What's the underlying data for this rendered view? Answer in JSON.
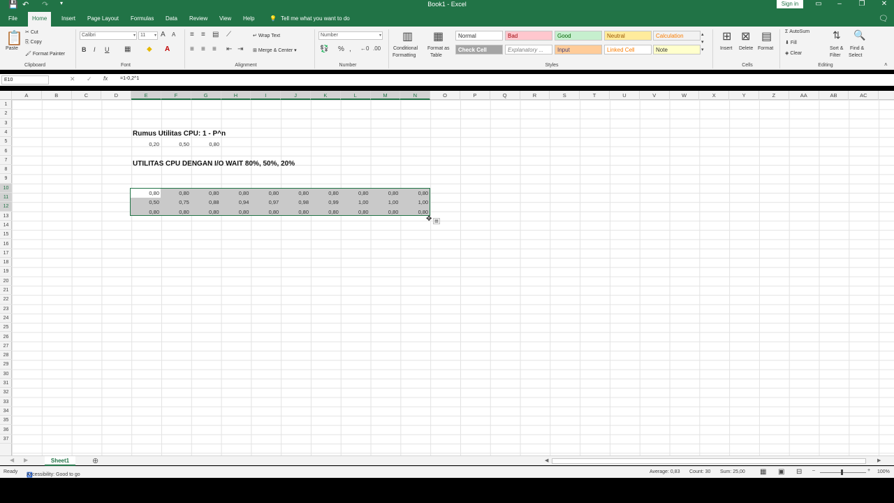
{
  "window": {
    "title": "Book1 - Excel",
    "signin_label": "Sign in"
  },
  "tabs": [
    {
      "label": "File"
    },
    {
      "label": "Home"
    },
    {
      "label": "Insert"
    },
    {
      "label": "Page Layout"
    },
    {
      "label": "Formulas"
    },
    {
      "label": "Data"
    },
    {
      "label": "Review"
    },
    {
      "label": "View"
    },
    {
      "label": "Help"
    }
  ],
  "tell_me": "Tell me what you want to do",
  "ribbon": {
    "clipboard": {
      "paste": "Paste",
      "cut": "Cut",
      "copy": "Copy",
      "format_painter": "Format Painter",
      "label": "Clipboard"
    },
    "font": {
      "name": "Calibri",
      "size": "11",
      "label": "Font"
    },
    "alignment": {
      "wrap": "Wrap Text",
      "merge": "Merge & Center",
      "label": "Alignment"
    },
    "number": {
      "format": "Number",
      "label": "Number"
    },
    "styles": {
      "conditional": "Conditional",
      "formatting": "Formatting",
      "format_as": "Format as",
      "table": "Table",
      "label": "Styles",
      "items": [
        {
          "label": "Normal",
          "bg": "#ffffff",
          "fg": "#333333"
        },
        {
          "label": "Bad",
          "bg": "#ffc7ce",
          "fg": "#9c0006"
        },
        {
          "label": "Good",
          "bg": "#c6efce",
          "fg": "#006100"
        },
        {
          "label": "Neutral",
          "bg": "#ffeb9c",
          "fg": "#9c5700"
        },
        {
          "label": "Calculation",
          "bg": "#f2f2f2",
          "fg": "#fa7d00"
        },
        {
          "label": "Check Cell",
          "bg": "#a5a5a5",
          "fg": "#ffffff"
        },
        {
          "label": "Explanatory ...",
          "bg": "#ffffff",
          "fg": "#7f7f7f"
        },
        {
          "label": "Input",
          "bg": "#ffcc99",
          "fg": "#3f3f76"
        },
        {
          "label": "Linked Cell",
          "bg": "#ffffff",
          "fg": "#fa7d00"
        },
        {
          "label": "Note",
          "bg": "#ffffcc",
          "fg": "#333333"
        }
      ]
    },
    "cells": {
      "insert": "Insert",
      "delete": "Delete",
      "format": "Format",
      "label": "Cells"
    },
    "editing": {
      "autosum": "AutoSum",
      "fill": "Fill",
      "clear": "Clear",
      "sort": "Sort &",
      "filter": "Filter",
      "find": "Find &",
      "select": "Select",
      "label": "Editing"
    }
  },
  "formula_bar": {
    "name_box": "E10",
    "fx": "fx",
    "content": "=1-0,2^1"
  },
  "columns": [
    "A",
    "B",
    "C",
    "D",
    "E",
    "F",
    "G",
    "H",
    "I",
    "J",
    "K",
    "L",
    "M",
    "N",
    "O",
    "P",
    "Q",
    "R",
    "S",
    "T",
    "U",
    "V",
    "W",
    "X",
    "Y",
    "Z",
    "AA",
    "AB",
    "AC"
  ],
  "rows": [
    "1",
    "2",
    "3",
    "4",
    "5",
    "6",
    "7",
    "8",
    "9",
    "10",
    "11",
    "12",
    "13",
    "14",
    "15",
    "16",
    "17",
    "18",
    "19",
    "20",
    "21",
    "22",
    "23",
    "24",
    "25",
    "26",
    "27",
    "28",
    "29",
    "30",
    "31",
    "32",
    "33",
    "34",
    "35",
    "36",
    "37"
  ],
  "sheet": {
    "heading1": "Rumus Utilitas CPU: 1 - P^n",
    "p_values": [
      "0,20",
      "0,50",
      "0,80"
    ],
    "heading2": "UTILITAS CPU DENGAN I/O WAIT 80%, 50%, 20%",
    "table": [
      [
        "0,80",
        "0,80",
        "0,80",
        "0,80",
        "0,80",
        "0,80",
        "0,80",
        "0,80",
        "0,80",
        "0,80"
      ],
      [
        "0,50",
        "0,75",
        "0,88",
        "0,94",
        "0,97",
        "0,98",
        "0,99",
        "1,00",
        "1,00",
        "1,00"
      ],
      [
        "0,80",
        "0,80",
        "0,80",
        "0,80",
        "0,80",
        "0,80",
        "0,80",
        "0,80",
        "0,80",
        "0,80"
      ]
    ]
  },
  "sheet_tab": "Sheet1",
  "status": {
    "ready": "Ready",
    "accessibility": "Accessibility: Good to go",
    "average": "Average: 0,83",
    "count": "Count: 30",
    "sum": "Sum: 25,00",
    "zoom": "100%"
  }
}
